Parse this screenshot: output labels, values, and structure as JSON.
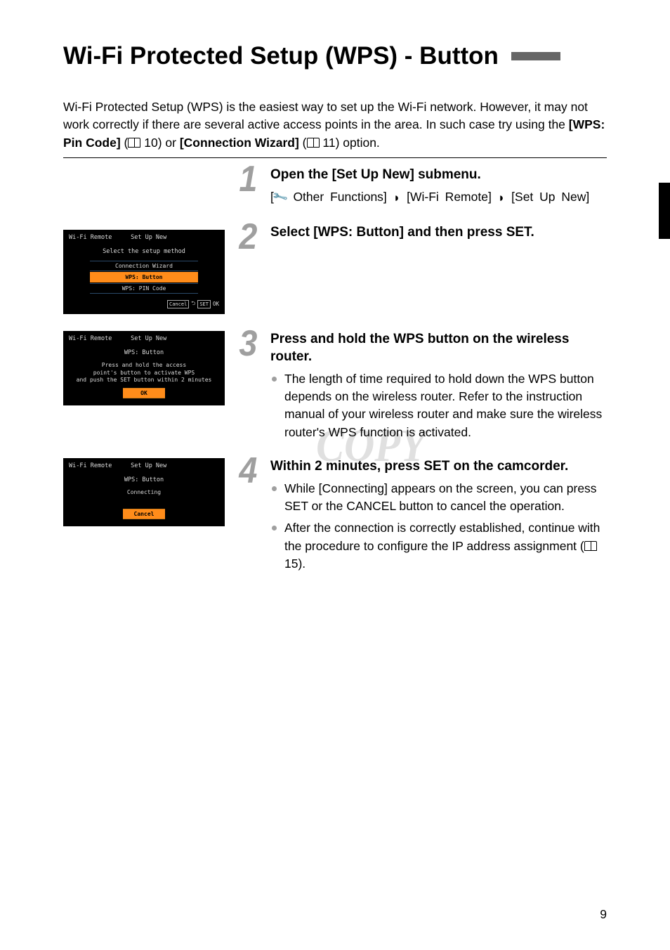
{
  "title": "Wi-Fi Protected Setup (WPS) - Button",
  "intro": {
    "text_1": "Wi-Fi Protected Setup (WPS) is the easiest way to set up the Wi-Fi network. However, it may not work correctly if there are several active access points in the area. In such case try using the ",
    "bold_1": "[WPS: Pin Code]",
    "ref_1": "10",
    "mid": ") or ",
    "bold_2": "[Connection Wizard]",
    "ref_2": "11",
    "tail": ") option."
  },
  "steps": {
    "s1": {
      "num": "1",
      "head": "Open the [Set Up New] submenu.",
      "path": {
        "a": "Other  Functions]",
        "b": "[Wi-Fi  Remote]",
        "c": "[Set  Up New]"
      }
    },
    "s2": {
      "num": "2",
      "head": "Select [WPS: Button] and then press SET."
    },
    "s3": {
      "num": "3",
      "head": "Press and hold the WPS button on the wireless router.",
      "bullet_1": "The length of time required to hold down the WPS button depends on the wireless router. Refer to the instruction manual of your wireless router and make sure the wireless router's WPS function is activated."
    },
    "s4": {
      "num": "4",
      "head": "Within 2 minutes, press SET on the camcorder.",
      "bullet_1": "While [Connecting] appears on the screen, you can press SET or the CANCEL button to cancel the operation.",
      "bullet_2_a": "After the connection is correctly established, continue with the procedure to configure the IP address assignment (",
      "bullet_2_ref": "15",
      "bullet_2_b": ")."
    }
  },
  "screens": {
    "screen1": {
      "left": "Wi-Fi Remote",
      "center": "Set Up New",
      "sub": "Select the setup method",
      "opt1": "Connection Wizard",
      "opt2": "WPS: Button",
      "opt3": "WPS: PIN Code",
      "cancel": "Cancel",
      "set": "SET",
      "ok": "OK"
    },
    "screen2": {
      "left": "Wi-Fi Remote",
      "center": "Set Up New",
      "sub": "WPS: Button",
      "instr1": "Press and hold the access",
      "instr2": "point's button to activate WPS",
      "instr3": "and push the SET button within 2 minutes",
      "btn": "OK"
    },
    "screen3": {
      "left": "Wi-Fi Remote",
      "center": "Set Up New",
      "sub": "WPS: Button",
      "status": "Connecting",
      "btn": "Cancel"
    }
  },
  "watermark": "COPY",
  "page_number": "9"
}
